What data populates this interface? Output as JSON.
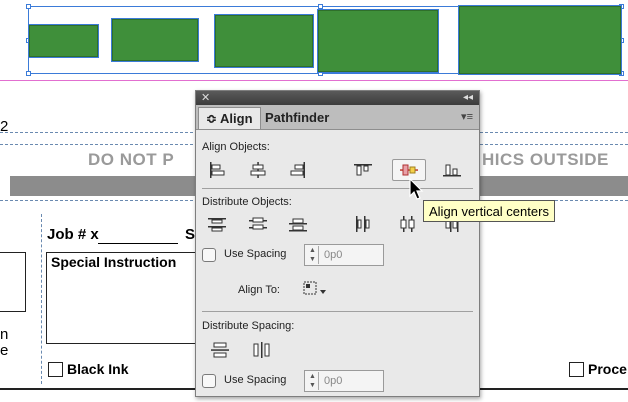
{
  "canvas": {
    "band_text": "DO NOT P",
    "band_text_right": "HICS OUTSIDE",
    "job_label": "Job # x",
    "job_s": "S",
    "special_instructions": "Special Instruction",
    "left_n": "n",
    "left_e": "e",
    "left_2": "2",
    "black_ink": "Black Ink",
    "process_label": "Proce",
    "shape_color": "#3f8f3a",
    "guide_color": "#e26fd0"
  },
  "panel": {
    "tabs": [
      {
        "label": "Align",
        "prefix": "≎"
      },
      {
        "label": "Pathfinder"
      }
    ],
    "align_objects_label": "Align Objects:",
    "distribute_objects_label": "Distribute Objects:",
    "use_spacing_label": "Use Spacing",
    "spacing_value": "0p0",
    "align_to_label": "Align To:",
    "distribute_spacing_label": "Distribute Spacing:",
    "use_spacing2_label": "Use Spacing",
    "spacing_value2": "0p0",
    "icons": {
      "align": [
        "align-left-edges-icon",
        "align-horizontal-centers-icon",
        "align-right-edges-icon",
        "align-top-edges-icon",
        "align-vertical-centers-icon",
        "align-bottom-edges-icon"
      ],
      "distribute": [
        "distribute-top-edges-icon",
        "distribute-vertical-centers-icon",
        "distribute-bottom-edges-icon",
        "distribute-left-edges-icon",
        "distribute-horizontal-centers-icon",
        "distribute-right-edges-icon"
      ]
    }
  },
  "tooltip": {
    "text": "Align vertical centers"
  }
}
